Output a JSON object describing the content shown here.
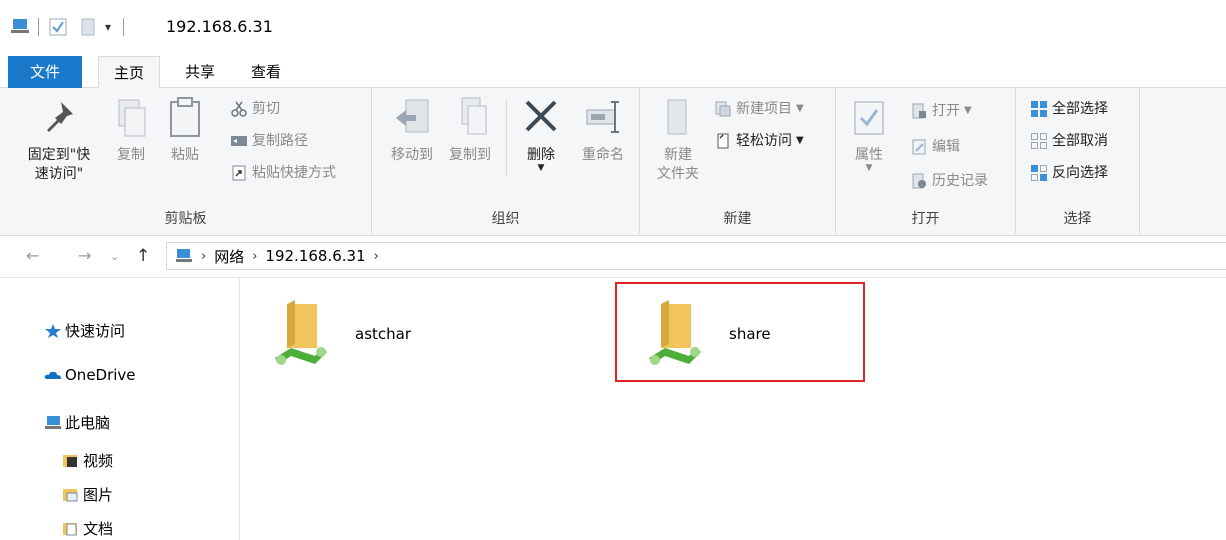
{
  "window": {
    "title": "192.168.6.31"
  },
  "ribbon_tabs": [
    "文件",
    "主页",
    "共享",
    "查看"
  ],
  "clipboard": {
    "pin_label_line1": "固定到\"快",
    "pin_label_line2": "速访问\"",
    "copy_label": "复制",
    "paste_label": "粘贴",
    "cut_label": "剪切",
    "copy_path_label": "复制路径",
    "paste_shortcut_label": "粘贴快捷方式",
    "group_label": "剪贴板"
  },
  "organize": {
    "move_to_label": "移动到",
    "copy_to_label": "复制到",
    "delete_label": "删除",
    "rename_label": "重命名",
    "group_label": "组织"
  },
  "new": {
    "new_folder_line1": "新建",
    "new_folder_line2": "文件夹",
    "new_item_label": "新建项目",
    "easy_access_label": "轻松访问",
    "group_label": "新建"
  },
  "open": {
    "properties_label": "属性",
    "open_label": "打开",
    "edit_label": "编辑",
    "history_label": "历史记录",
    "group_label": "打开"
  },
  "select": {
    "select_all_label": "全部选择",
    "select_none_label": "全部取消",
    "invert_label": "反向选择",
    "group_label": "选择"
  },
  "address": {
    "crumbs": [
      "网络",
      "192.168.6.31"
    ]
  },
  "nav_pane": {
    "quick_access": "快速访问",
    "onedrive": "OneDrive",
    "this_pc": "此电脑",
    "videos": "视频",
    "pictures": "图片",
    "documents": "文档"
  },
  "shares": [
    {
      "name": "astchar"
    },
    {
      "name": "share"
    }
  ],
  "colors": {
    "accent": "#1979ca",
    "highlight_border": "#e0241f",
    "folder": "#f2c55c",
    "network_green": "#4caf3a"
  }
}
